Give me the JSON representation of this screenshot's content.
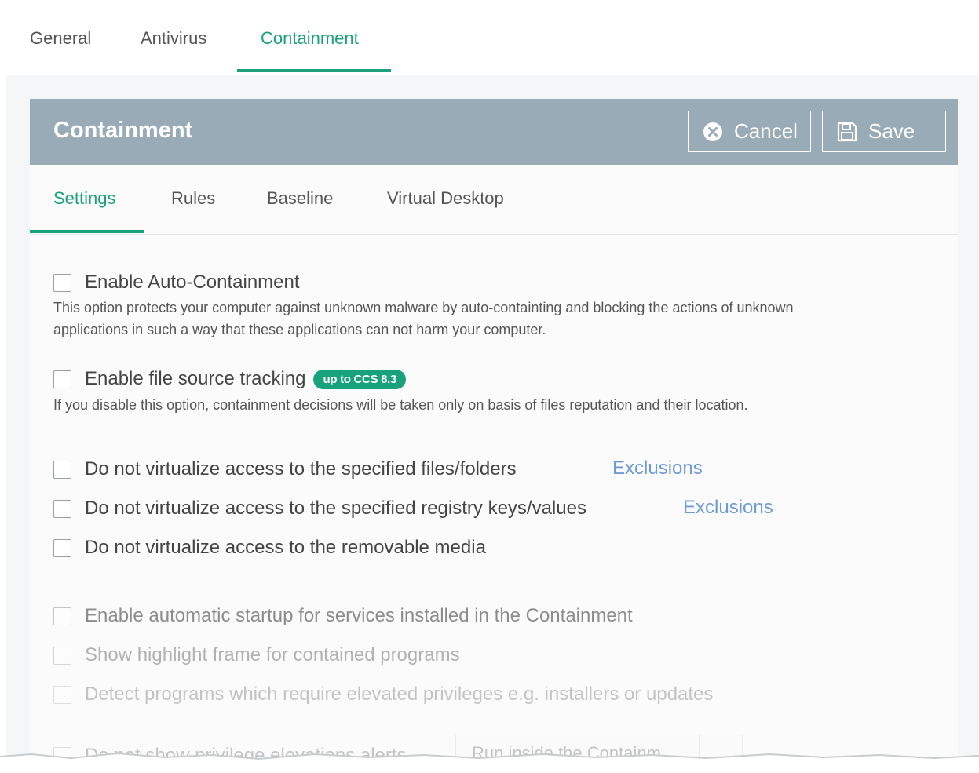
{
  "top_tabs": [
    {
      "label": "General"
    },
    {
      "label": "Antivirus"
    },
    {
      "label": "Containment"
    }
  ],
  "panel": {
    "title": "Containment",
    "cancel_label": "Cancel",
    "save_label": "Save",
    "cancel_icon": "close-circle-icon",
    "save_icon": "floppy-disk-icon"
  },
  "inner_tabs": [
    {
      "label": "Settings"
    },
    {
      "label": "Rules"
    },
    {
      "label": "Baseline"
    },
    {
      "label": "Virtual Desktop"
    }
  ],
  "options": {
    "auto_containment": {
      "label": "Enable Auto-Containment",
      "checked": false,
      "description_line1": "This option protects your computer against unknown malware by auto-containting and blocking the actions of unknown",
      "description_line2": "applications in such a way that these applications can not harm your computer."
    },
    "file_source_tracking": {
      "label": "Enable file source tracking",
      "badge": "up to CCS 8.3",
      "checked": false,
      "description": "If you disable this option, containment decisions will be taken only on basis of files reputation and their location."
    },
    "no_virt_files": {
      "label": "Do not virtualize access to the specified files/folders",
      "link": "Exclusions",
      "checked": false
    },
    "no_virt_registry": {
      "label": "Do not virtualize access to the specified registry keys/values",
      "link": "Exclusions",
      "checked": false
    },
    "no_virt_removable": {
      "label": "Do not virtualize access to the removable media",
      "checked": false
    },
    "auto_startup": {
      "label": "Enable automatic startup for services installed in the Containment",
      "checked": false
    },
    "highlight_frame": {
      "label": "Show highlight frame for contained programs",
      "checked": false
    },
    "detect_elevated": {
      "label": "Detect programs which require elevated privileges e.g. installers or updates",
      "checked": false
    },
    "no_privilege_alerts": {
      "label": "Do not show privilege elevations alerts",
      "checked": false,
      "dropdown_value": "Run inside the Containm"
    }
  },
  "colors": {
    "accent": "#1aa17b",
    "header_bg": "#9aabb8",
    "link": "#6c9bd8"
  }
}
